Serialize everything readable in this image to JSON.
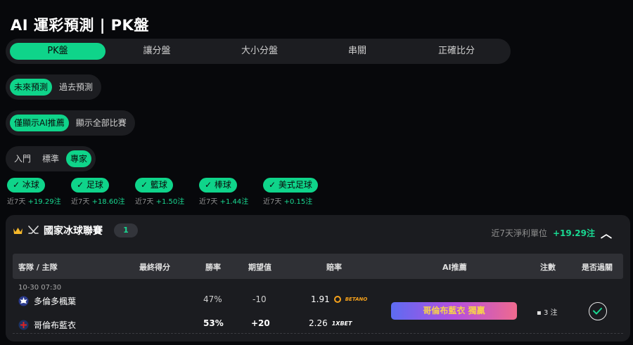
{
  "page": {
    "title": "AI 運彩預測 | PK盤"
  },
  "main_tabs": [
    "PK盤",
    "讓分盤",
    "大小分盤",
    "串關",
    "正確比分"
  ],
  "time_filter": [
    "未來預測",
    "過去預測"
  ],
  "display_filter": [
    "僅顯示AI推薦",
    "顯示全部比賽"
  ],
  "level_filter": [
    "入門",
    "標準",
    "專家"
  ],
  "sports": [
    {
      "label": "✓ 冰球",
      "stat_prefix": "近7天",
      "stat_value": "+19.29注"
    },
    {
      "label": "✓ 足球",
      "stat_prefix": "近7天",
      "stat_value": "+18.60注"
    },
    {
      "label": "✓ 籃球",
      "stat_prefix": "近7天",
      "stat_value": "+1.50注"
    },
    {
      "label": "✓ 棒球",
      "stat_prefix": "近7天",
      "stat_value": "+1.44注"
    },
    {
      "label": "✓ 美式足球",
      "stat_prefix": "近7天",
      "stat_value": "+0.15注"
    }
  ],
  "league": {
    "name": "國家冰球聯賽",
    "count": "1",
    "profit_label": "近7天淨利單位",
    "profit_value": "+19.29注"
  },
  "table": {
    "headers": [
      "客隊 / 主隊",
      "最終得分",
      "勝率",
      "期望值",
      "賠率",
      "AI推薦",
      "注數",
      "是否過關"
    ]
  },
  "match": {
    "time": "10-30 07:30",
    "away": {
      "name": "多倫多楓葉",
      "win_rate": "47%",
      "ev": "-10",
      "odds": "1.91",
      "bookmaker": "BETANO"
    },
    "home": {
      "name": "哥倫布藍衣",
      "win_rate": "53%",
      "ev": "+20",
      "odds": "2.26",
      "bookmaker": "1XBET"
    },
    "ai_pick": "哥倫布藍衣 獨贏",
    "stake": "3 注"
  },
  "colors": {
    "accent": "#0fd48a",
    "background": "#07080b",
    "panel": "#1b1c20"
  }
}
